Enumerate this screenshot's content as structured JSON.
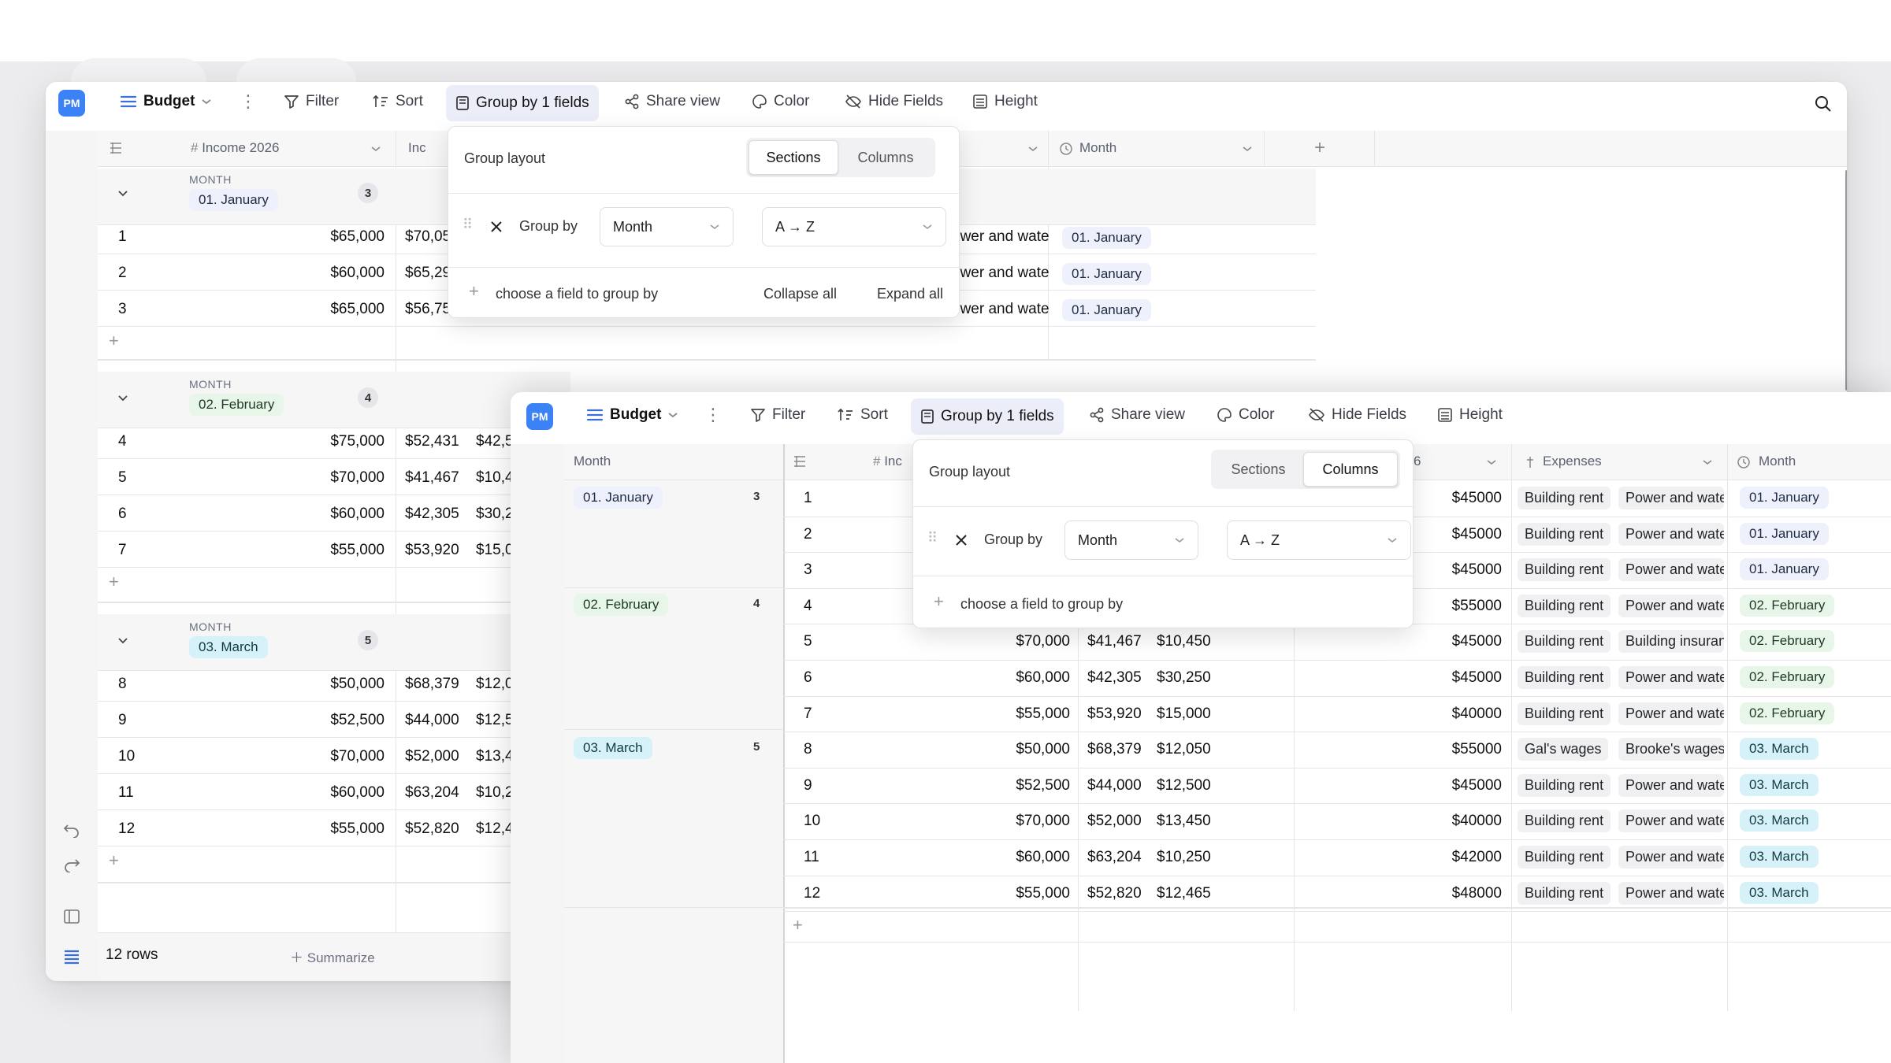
{
  "colors": {
    "accent": "#3b82f6",
    "jan": "#eef1fb",
    "feb": "#e8f6ea",
    "mar": "#d6f1f7"
  },
  "toolbar": {
    "logo": "PM",
    "view": "Budget",
    "filter": "Filter",
    "sort": "Sort",
    "group": "Group by 1 fields",
    "share": "Share view",
    "color": "Color",
    "hide": "Hide Fields",
    "height": "Height"
  },
  "w1": {
    "headers": {
      "col1": "Income 2026",
      "col2": "Inc",
      "col_month": "Month"
    },
    "groups": [
      {
        "label_small": "MONTH",
        "value": "01. January",
        "count": "3",
        "rows": [
          {
            "n": "1",
            "a": "$65,000",
            "b": "$70,05",
            "e": "ower and wate",
            "m": "01. January"
          },
          {
            "n": "2",
            "a": "$60,000",
            "b": "$65,29",
            "e": "ower and wate",
            "m": "01. January"
          },
          {
            "n": "3",
            "a": "$65,000",
            "b": "$56,75",
            "e": "ower and wate",
            "m": "01. January"
          }
        ]
      },
      {
        "label_small": "MONTH",
        "value": "02. February",
        "count": "4",
        "rows": [
          {
            "n": "4",
            "a": "$75,000",
            "b": "$52,431",
            "c": "$42,5"
          },
          {
            "n": "5",
            "a": "$70,000",
            "b": "$41,467",
            "c": "$10,4"
          },
          {
            "n": "6",
            "a": "$60,000",
            "b": "$42,305",
            "c": "$30,2"
          },
          {
            "n": "7",
            "a": "$55,000",
            "b": "$53,920",
            "c": "$15,0"
          }
        ]
      },
      {
        "label_small": "MONTH",
        "value": "03. March",
        "count": "5",
        "rows": [
          {
            "n": "8",
            "a": "$50,000",
            "b": "$68,379",
            "c": "$12,0"
          },
          {
            "n": "9",
            "a": "$52,500",
            "b": "$44,000",
            "c": "$12,5"
          },
          {
            "n": "10",
            "a": "$70,000",
            "b": "$52,000",
            "c": "$13,4"
          },
          {
            "n": "11",
            "a": "$60,000",
            "b": "$63,204",
            "c": "$10,2"
          },
          {
            "n": "12",
            "a": "$55,000",
            "b": "$52,820",
            "c": "$12,4"
          }
        ]
      }
    ],
    "footer": {
      "rows": "12 rows",
      "summarize": "Summarize"
    },
    "popup": {
      "title": "Group layout",
      "sections": "Sections",
      "columns": "Columns",
      "group_by": "Group by",
      "field": "Month",
      "order": "A → Z",
      "choose": "choose a field to group by",
      "collapse": "Collapse all",
      "expand": "Expand all"
    }
  },
  "w2": {
    "headers": {
      "month": "Month",
      "inc": "Inc",
      "col6": "6",
      "expenses": "Expenses",
      "month2": "Month"
    },
    "groups": [
      {
        "value": "01. January",
        "count": "3"
      },
      {
        "value": "02. February",
        "count": "4"
      },
      {
        "value": "03. March",
        "count": "5"
      }
    ],
    "rows": [
      {
        "n": "1",
        "e1": "$45000",
        "t1": "Building rent",
        "t2": "Power and wate",
        "m": "01. January",
        "g": "jan"
      },
      {
        "n": "2",
        "e1": "$45000",
        "t1": "Building rent",
        "t2": "Power and wate",
        "m": "01. January",
        "g": "jan"
      },
      {
        "n": "3",
        "e1": "$45000",
        "t1": "Building rent",
        "t2": "Power and wate",
        "m": "01. January",
        "g": "jan"
      },
      {
        "n": "4",
        "e1": "$55000",
        "t1": "Building rent",
        "t2": "Power and wate",
        "m": "02. February",
        "g": "feb"
      },
      {
        "n": "5",
        "a": "$70,000",
        "b": "$41,467",
        "c": "$10,450",
        "e1": "$45000",
        "t1": "Building rent",
        "t2": "Building insuranc",
        "m": "02. February",
        "g": "feb"
      },
      {
        "n": "6",
        "a": "$60,000",
        "b": "$42,305",
        "c": "$30,250",
        "e1": "$45000",
        "t1": "Building rent",
        "t2": "Power and wate",
        "m": "02. February",
        "g": "feb"
      },
      {
        "n": "7",
        "a": "$55,000",
        "b": "$53,920",
        "c": "$15,000",
        "e1": "$40000",
        "t1": "Building rent",
        "t2": "Power and wate",
        "m": "02. February",
        "g": "feb"
      },
      {
        "n": "8",
        "a": "$50,000",
        "b": "$68,379",
        "c": "$12,050",
        "e1": "$55000",
        "t1": "Gal's wages",
        "t2": "Brooke's wages",
        "m": "03. March",
        "g": "mar"
      },
      {
        "n": "9",
        "a": "$52,500",
        "b": "$44,000",
        "c": "$12,500",
        "e1": "$45000",
        "t1": "Building rent",
        "t2": "Power and wate",
        "m": "03. March",
        "g": "mar"
      },
      {
        "n": "10",
        "a": "$70,000",
        "b": "$52,000",
        "c": "$13,450",
        "e1": "$40000",
        "t1": "Building rent",
        "t2": "Power and wate",
        "m": "03. March",
        "g": "mar"
      },
      {
        "n": "11",
        "a": "$60,000",
        "b": "$63,204",
        "c": "$10,250",
        "e1": "$42000",
        "t1": "Building rent",
        "t2": "Power and wate",
        "m": "03. March",
        "g": "mar"
      },
      {
        "n": "12",
        "a": "$55,000",
        "b": "$52,820",
        "c": "$12,465",
        "e1": "$48000",
        "t1": "Building rent",
        "t2": "Power and wate",
        "m": "03. March",
        "g": "mar"
      }
    ],
    "popup": {
      "title": "Group layout",
      "sections": "Sections",
      "columns": "Columns",
      "group_by": "Group by",
      "field": "Month",
      "order": "A → Z",
      "choose": "choose a field to group by"
    }
  }
}
